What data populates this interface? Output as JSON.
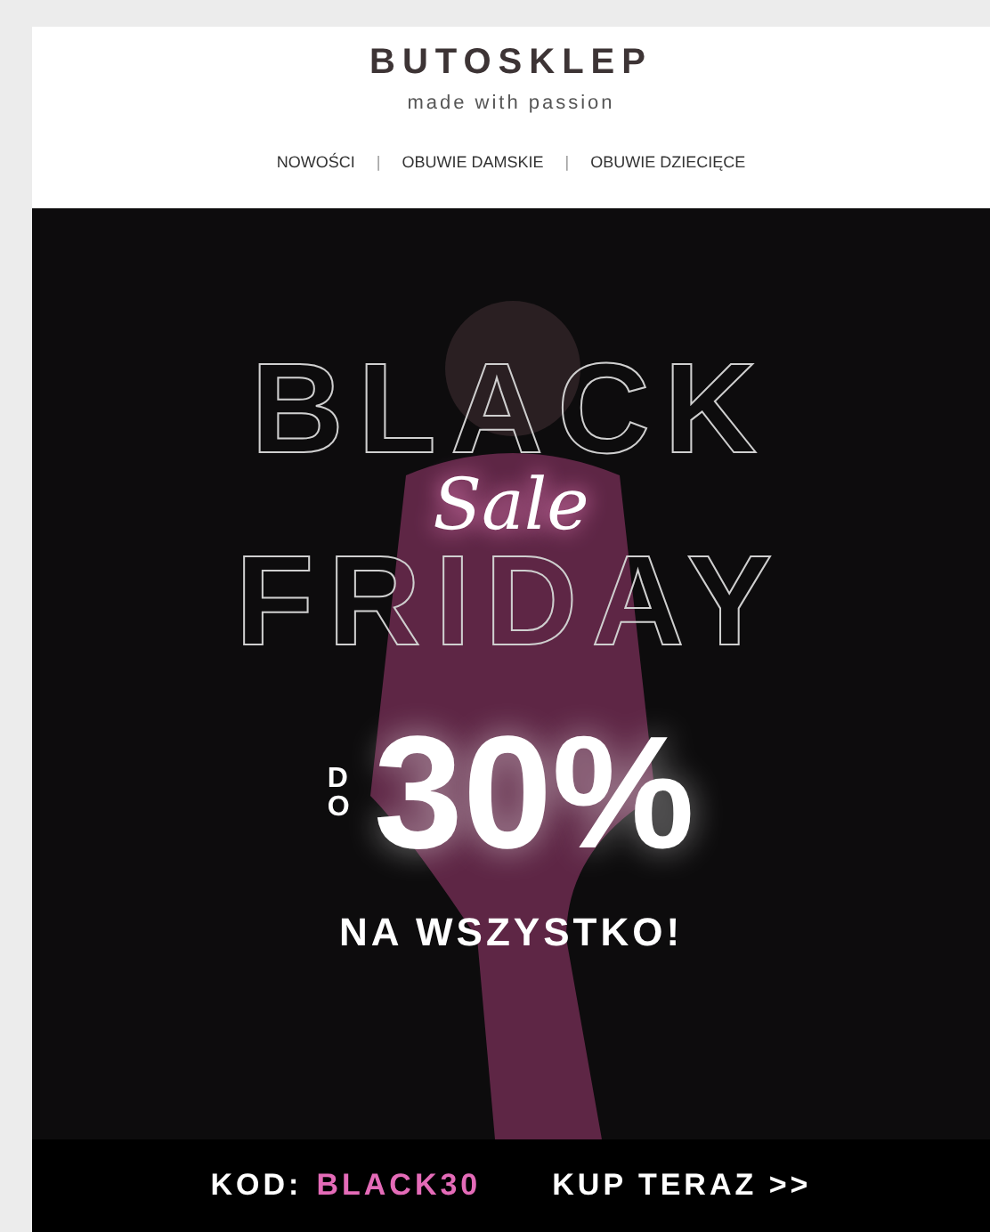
{
  "logo": {
    "name": "BUTOSKLEP",
    "tagline": "made with passion"
  },
  "nav": [
    {
      "kind": "link",
      "label": "NOWOŚCI"
    },
    {
      "kind": "separator",
      "label": "|"
    },
    {
      "kind": "link",
      "label": "OBUWIE DAMSKIE"
    },
    {
      "kind": "separator",
      "label": "|"
    },
    {
      "kind": "link",
      "label": "OBUWIE DZIECIĘCE"
    }
  ],
  "banner": {
    "headline": [
      "BLACK",
      "FRIDAY"
    ],
    "script": "Sale",
    "prefix": "DO",
    "discount": "30%",
    "subline": "NA WSZYSTKO!"
  },
  "footer": {
    "code_label": "KOD:",
    "code": "BLACK30",
    "cta": "KUP TERAZ >>"
  }
}
